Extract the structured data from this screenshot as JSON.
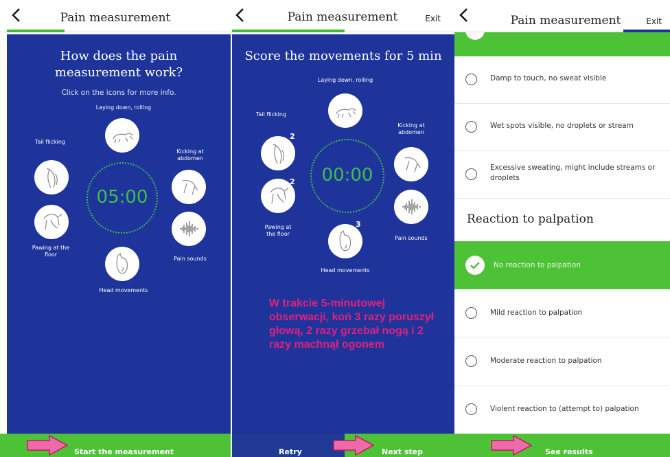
{
  "screen1": {
    "title": "Pain measurement",
    "heading": "How does the pain measurement work?",
    "subheading": "Click on the icons for more info.",
    "labels": {
      "laying": "Laying down, rolling",
      "tail": "Tail flicking",
      "kicking": "Kicking at abdomen",
      "pawing": "Pawing at the floor",
      "sounds": "Pain sounds",
      "head": "Head movements"
    },
    "timer": "05:00",
    "start_button": "Start the measurement"
  },
  "screen2": {
    "title": "Pain measurement",
    "exit": "Exit",
    "heading": "Score the movements for 5 min",
    "labels": {
      "laying": "Laying down, rolling",
      "tail": "Tail flicking",
      "kicking": "Kicking at abdomen",
      "pawing": "Pawing at the floor",
      "sounds": "Pain sounds",
      "head": "Head movements"
    },
    "counts": {
      "tail": "2",
      "pawing": "2",
      "head": "3"
    },
    "timer": "00:00",
    "retry_button": "Retry",
    "next_button": "Next step",
    "annotation": "W trakcie 5-minutowej obserwacji, koń 3 razy poruszył głową, 2 razy grzebał nogą i 2 razy machnął ogonem"
  },
  "screen3": {
    "title": "Pain measurement",
    "exit": "Exit",
    "sweat_options": [
      "Damp to touch, no sweat visible",
      "Wet spots visible, no droplets or stream",
      "Excessive sweating, might include streams or droplets"
    ],
    "palpation_title": "Reaction to palpation",
    "palpation_options": [
      "No reaction to palpation",
      "Mild reaction to palpation",
      "Moderate reaction to palpation",
      "Violent reaction to (attempt to) palpation"
    ],
    "selected_palpation": "No reaction to palpation",
    "results_button": "See results"
  },
  "colors": {
    "blue": "#1e349a",
    "green": "#4ec236",
    "timer_green": "#3fbf4a",
    "annotation_pink": "#e0207e",
    "arrow_pink": "#ee6aaa"
  },
  "icons": [
    "back-chevron-icon",
    "horse-rolling-icon",
    "horse-tail-icon",
    "horse-kicking-icon",
    "horse-pawing-icon",
    "sound-wave-icon",
    "horse-head-icon",
    "check-icon",
    "pink-arrow-icon"
  ]
}
